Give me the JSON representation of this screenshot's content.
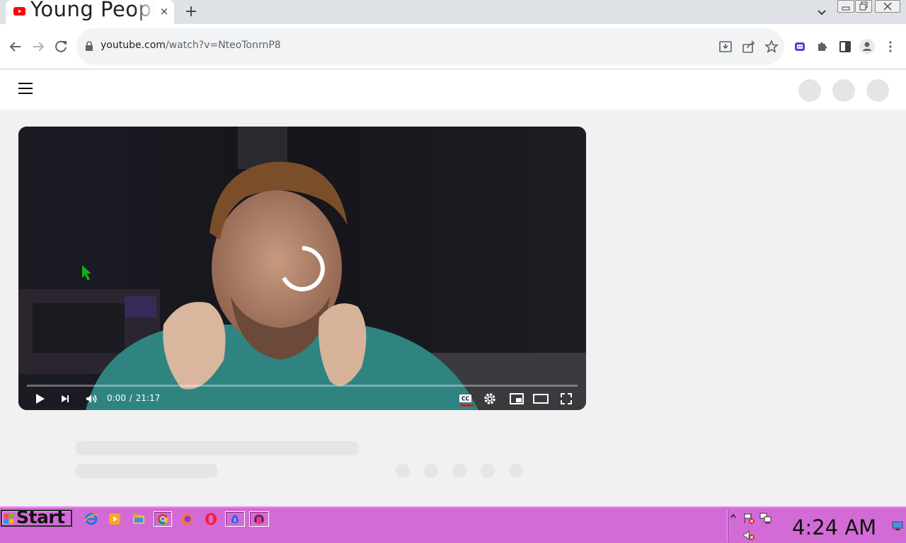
{
  "browser": {
    "tab": {
      "title": "Young People",
      "close_label": "×"
    },
    "new_tab_label": "+",
    "address": {
      "host": "youtube.com",
      "path": "/watch?v=NteoTonrnP8"
    }
  },
  "player": {
    "current_time": "0:00",
    "separator": "/",
    "duration": "21:17",
    "progress_fraction": 0.0
  },
  "taskbar": {
    "start_label": "Start",
    "clock": "4:24 AM"
  },
  "colors": {
    "youtube_red": "#ff0000",
    "taskbar": "#d36bd6",
    "page_bg": "#f1f1f1",
    "skeleton": "#e5e5e5"
  },
  "icons": {
    "tab": "youtube-favicon",
    "toolbar": [
      "back-arrow-icon",
      "forward-arrow-icon",
      "reload-icon",
      "lock-icon",
      "install-app-icon",
      "share-icon",
      "bookmark-star-icon",
      "extension-app-icon",
      "puzzle-extensions-icon",
      "side-panel-icon",
      "profile-icon",
      "more-vert-icon"
    ],
    "player": [
      "play-icon",
      "next-icon",
      "volume-icon",
      "captions-icon",
      "settings-gear-icon",
      "miniplayer-icon",
      "theater-mode-icon",
      "fullscreen-icon"
    ]
  }
}
